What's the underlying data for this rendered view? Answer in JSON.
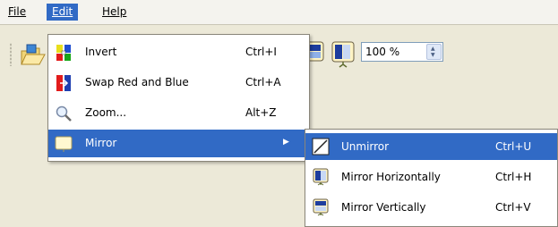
{
  "menubar": {
    "file": "File",
    "edit": "Edit",
    "help": "Help"
  },
  "toolbar": {
    "zoom_value": "100 %",
    "icons": [
      "open-icon",
      "mirror-vertical-icon",
      "mirror-horizontal-icon"
    ]
  },
  "edit_menu": {
    "items": [
      {
        "label": "Invert",
        "shortcut": "Ctrl+I",
        "icon": "invert-icon"
      },
      {
        "label": "Swap Red and Blue",
        "shortcut": "Ctrl+A",
        "icon": "swap-red-blue-icon"
      },
      {
        "label": "Zoom...",
        "shortcut": "Alt+Z",
        "icon": "magnifier-icon"
      },
      {
        "label": "Mirror",
        "shortcut": "",
        "icon": "mirror-icon"
      }
    ]
  },
  "mirror_submenu": {
    "items": [
      {
        "label": "Unmirror",
        "shortcut": "Ctrl+U",
        "icon": "unmirror-icon"
      },
      {
        "label": "Mirror Horizontally",
        "shortcut": "Ctrl+H",
        "icon": "mirror-horizontal-icon"
      },
      {
        "label": "Mirror Vertically",
        "shortcut": "Ctrl+V",
        "icon": "mirror-vertical-icon"
      }
    ]
  },
  "colors": {
    "highlight": "#316ac5",
    "menu_background": "#ffffff",
    "toolbar_background": "#ece9d8"
  }
}
